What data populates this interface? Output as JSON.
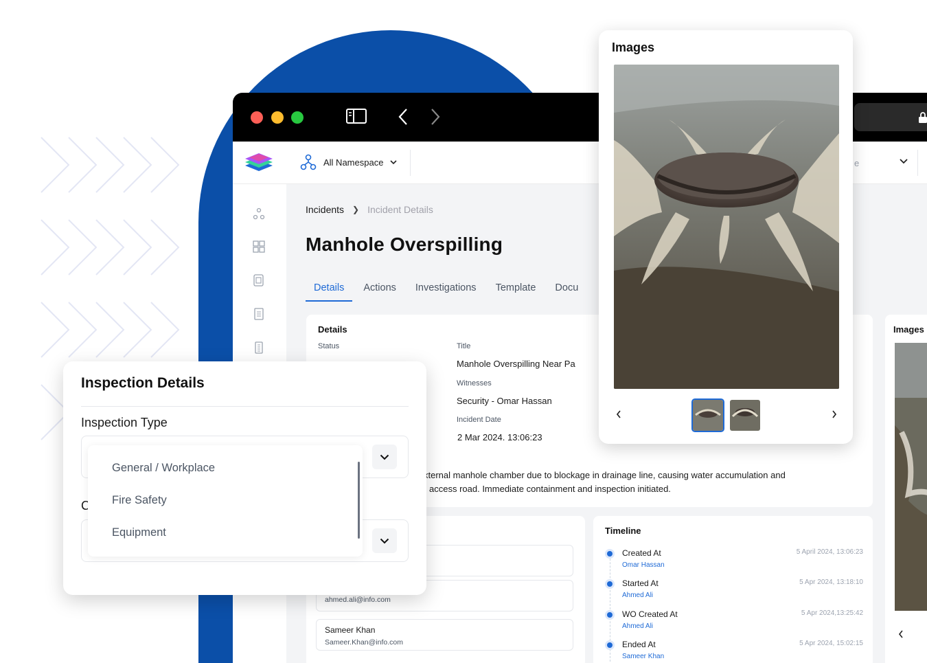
{
  "window": {
    "namespace_label": "All Namespace",
    "right_select_partial": "e",
    "breadcrumb": {
      "root": "Incidents",
      "current": "Incident Details"
    },
    "page_title": "Manhole Overspilling",
    "tabs": [
      "Details",
      "Actions",
      "Investigations",
      "Template",
      "Docu"
    ]
  },
  "details": {
    "heading": "Details",
    "status_label": "Status",
    "title_label": "Title",
    "title_value": "Manhole Overspilling Near Pa",
    "witnesses_label": "Witnesses",
    "witnesses_value": "Security - Omar Hassan",
    "incident_date_label": "Incident Date",
    "incident_date_value": "2 Mar 2024. 13:06:23",
    "description_line1": "xternal manhole chamber due to blockage in drainage line, causing water accumulation and",
    "description_line2": "access road. Immediate containment and inspection initiated."
  },
  "people": [
    {
      "name": "",
      "email": "ahmed.ali@info.com"
    },
    {
      "name": "Sameer Khan",
      "email": "Sameer.Khan@info.com"
    }
  ],
  "timeline": {
    "heading": "Timeline",
    "items": [
      {
        "title": "Created At",
        "user": "Omar Hassan",
        "time": "5 April 2024, 13:06:23"
      },
      {
        "title": "Started At",
        "user": "Ahmed Ali",
        "time": "5 Apr 2024, 13:18:10"
      },
      {
        "title": "WO Created At",
        "user": "Ahmed Ali",
        "time": "5 Apr 2024,13:25:42"
      },
      {
        "title": "Ended At",
        "user": "Sameer Khan",
        "time": "5 Apr 2024, 15:02:15"
      }
    ]
  },
  "images_bg": {
    "heading": "Images"
  },
  "images_panel": {
    "title": "Images",
    "thumbnail_count": 2
  },
  "inspection": {
    "title": "Inspection Details",
    "type_label": "Inspection Type",
    "second_label_partial": "C",
    "options": [
      "General / Workplace",
      "Fire Safety",
      "Equipment"
    ]
  },
  "colors": {
    "accent": "#1e6ad6",
    "brand_blue": "#0b4fa8"
  }
}
